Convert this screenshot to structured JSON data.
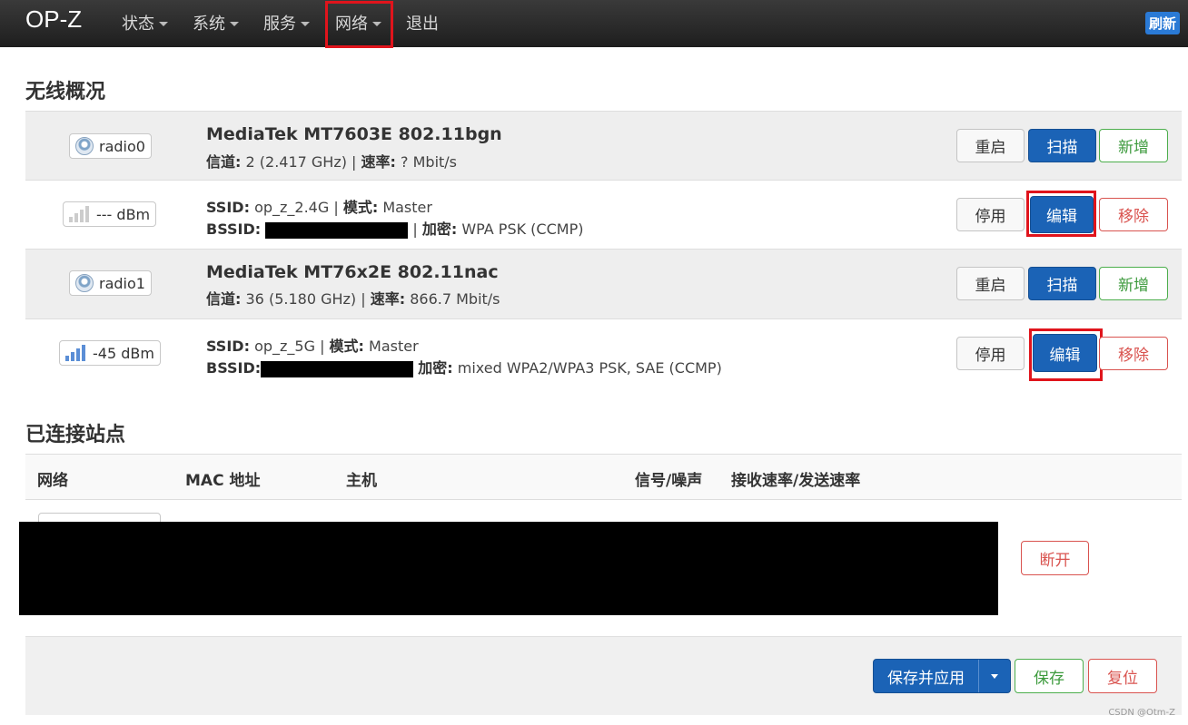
{
  "header": {
    "brand": "OP-Z",
    "menu": [
      {
        "label": "状态",
        "dropdown": true
      },
      {
        "label": "系统",
        "dropdown": true
      },
      {
        "label": "服务",
        "dropdown": true
      },
      {
        "label": "网络",
        "dropdown": true,
        "highlighted": true
      },
      {
        "label": "退出",
        "dropdown": false
      }
    ],
    "refresh_label": "刷新"
  },
  "wireless": {
    "title": "无线概况",
    "rows": [
      {
        "type": "radio",
        "badge": "radio0",
        "title": "MediaTek MT7603E 802.11bgn",
        "line1_k1": "信道:",
        "line1_v1": "2 (2.417 GHz)",
        "line1_k2": "速率:",
        "line1_v2": "? Mbit/s",
        "buttons": [
          "重启",
          "扫描",
          "新增"
        ]
      },
      {
        "type": "net",
        "badge": "--- dBm",
        "signal_bars_lit": 0,
        "ssid_k": "SSID:",
        "ssid": "op_z_2.4G",
        "mode_k": "模式:",
        "mode": "Master",
        "bssid_k": "BSSID:",
        "enc_k": "加密:",
        "enc": "WPA PSK (CCMP)",
        "buttons": [
          "停用",
          "编辑",
          "移除"
        ]
      },
      {
        "type": "radio",
        "badge": "radio1",
        "title": "MediaTek MT76x2E 802.11nac",
        "line1_k1": "信道:",
        "line1_v1": "36 (5.180 GHz)",
        "line1_k2": "速率:",
        "line1_v2": "866.7 Mbit/s",
        "buttons": [
          "重启",
          "扫描",
          "新增"
        ]
      },
      {
        "type": "net",
        "badge": "-45 dBm",
        "signal_bars_lit": 4,
        "ssid_k": "SSID:",
        "ssid": "op_z_5G",
        "mode_k": "模式:",
        "mode": "Master",
        "bssid_k": "BSSID:",
        "enc_k": "加密:",
        "enc": "mixed WPA2/WPA3 PSK, SAE (CCMP)",
        "buttons": [
          "停用",
          "编辑",
          "移除"
        ]
      }
    ]
  },
  "stations": {
    "title": "已连接站点",
    "columns": [
      "网络",
      "MAC 地址",
      "主机",
      "信号/噪声",
      "接收速率/发送速率"
    ],
    "rows": [
      {
        "disconnect_label": "断开"
      }
    ]
  },
  "footer": {
    "save_apply": "保存并应用",
    "save": "保存",
    "reset": "复位"
  },
  "watermark": "CSDN @Otm-Z",
  "colors": {
    "primary": "#1b63b6",
    "success": "#4cae4c",
    "danger": "#d9534f",
    "highlight": "#e0141c",
    "header": "#2a2a2a"
  }
}
